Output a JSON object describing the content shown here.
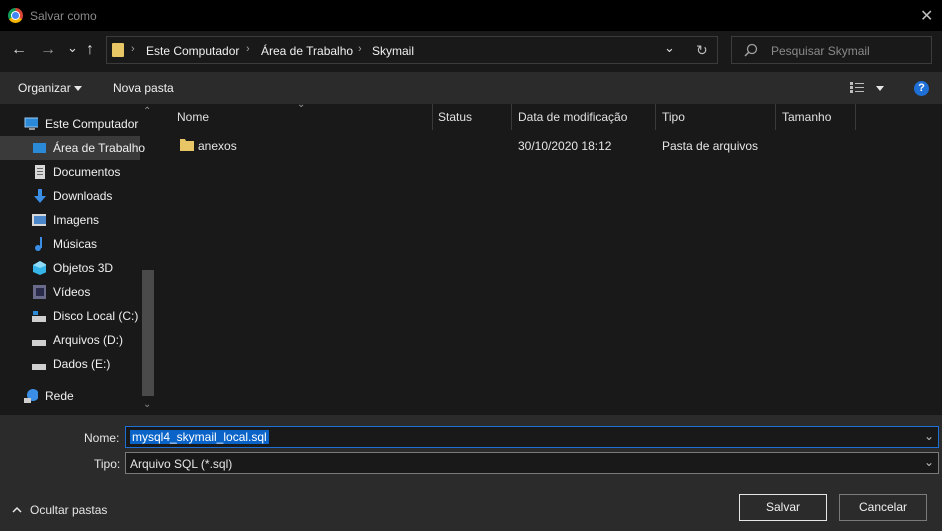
{
  "window": {
    "title": "Salvar como",
    "close_glyph": "✕"
  },
  "nav": {
    "back_glyph": "←",
    "forward_glyph": "→",
    "recent_glyph": "⌄",
    "up_glyph": "↑",
    "breadcrumbs": [
      "Este Computador",
      "Área de Trabalho",
      "Skymail"
    ],
    "crumb_sep": "›",
    "refresh_glyph": "↻",
    "search_placeholder": "Pesquisar Skymail"
  },
  "toolbar": {
    "organize_label": "Organizar",
    "new_folder_label": "Nova pasta",
    "help_label": "?"
  },
  "sidebar": {
    "items": [
      {
        "label": "Este Computador",
        "icon": "computer-icon"
      },
      {
        "label": "Área de Trabalho",
        "icon": "desktop-icon"
      },
      {
        "label": "Documentos",
        "icon": "documents-icon"
      },
      {
        "label": "Downloads",
        "icon": "downloads-icon"
      },
      {
        "label": "Imagens",
        "icon": "images-icon"
      },
      {
        "label": "Músicas",
        "icon": "music-icon"
      },
      {
        "label": "Objetos 3D",
        "icon": "objects-3d-icon"
      },
      {
        "label": "Vídeos",
        "icon": "videos-icon"
      },
      {
        "label": "Disco Local (C:)",
        "icon": "drive-c-icon"
      },
      {
        "label": "Arquivos (D:)",
        "icon": "drive-d-icon"
      },
      {
        "label": "Dados (E:)",
        "icon": "drive-e-icon"
      },
      {
        "label": "Rede",
        "icon": "network-icon"
      }
    ],
    "selected_index": 1
  },
  "filelist": {
    "columns": [
      "Nome",
      "Status",
      "Data de modificação",
      "Tipo",
      "Tamanho"
    ],
    "rows": [
      {
        "name": "anexos",
        "status": "",
        "modified": "30/10/2020 18:12",
        "type": "Pasta de arquivos",
        "size": ""
      }
    ]
  },
  "form": {
    "name_label": "Nome:",
    "name_value": "mysql4_skymail_local.sql",
    "type_label": "Tipo:",
    "type_value": "Arquivo SQL (*.sql)"
  },
  "footer": {
    "hide_folders_label": "Ocultar pastas",
    "save_label": "Salvar",
    "cancel_label": "Cancelar"
  },
  "colors": {
    "accent": "#1e70d6",
    "folder": "#e8c565",
    "selection": "#0a64c8"
  }
}
